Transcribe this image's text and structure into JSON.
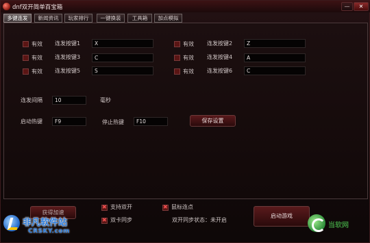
{
  "window": {
    "title": "dnf双开简单百宝箱",
    "min_label": "—",
    "close_label": "✕"
  },
  "tabs": [
    {
      "label": "多键连发",
      "active": true
    },
    {
      "label": "新闻资讯",
      "active": false
    },
    {
      "label": "玩家排行",
      "active": false
    },
    {
      "label": "一键换装",
      "active": false
    },
    {
      "label": "工具箱",
      "active": false
    },
    {
      "label": "加点模拟",
      "active": false
    }
  ],
  "keys": [
    {
      "enabled_label": "有效",
      "key_label": "连发按键1",
      "value": "X"
    },
    {
      "enabled_label": "有效",
      "key_label": "连发按键2",
      "value": "Z"
    },
    {
      "enabled_label": "有效",
      "key_label": "连发按键3",
      "value": "C"
    },
    {
      "enabled_label": "有效",
      "key_label": "连发按键4",
      "value": "A"
    },
    {
      "enabled_label": "有效",
      "key_label": "连发按键5",
      "value": "S"
    },
    {
      "enabled_label": "有效",
      "key_label": "连发按键6",
      "value": "C"
    }
  ],
  "interval": {
    "label": "连发间隔",
    "value": "10",
    "unit": "毫秒"
  },
  "hotkeys": {
    "start_label": "启动热键",
    "start_value": "F9",
    "stop_label": "停止热键",
    "stop_value": "F10",
    "save_label": "保存设置"
  },
  "bottom": {
    "left_button_label": "获得加速",
    "options": [
      {
        "label": "支持双开",
        "checked": true
      },
      {
        "label": "鼠标连点",
        "checked": true
      },
      {
        "label": "双卡同步",
        "checked": false
      }
    ],
    "sync_status_label": "双开同步状态：",
    "sync_status_value": "未开启",
    "start_game_label": "启动游戏"
  },
  "watermarks": {
    "left_cn": "非凡软件站",
    "left_en": "CRSKY.com",
    "right_text": "当软网"
  }
}
